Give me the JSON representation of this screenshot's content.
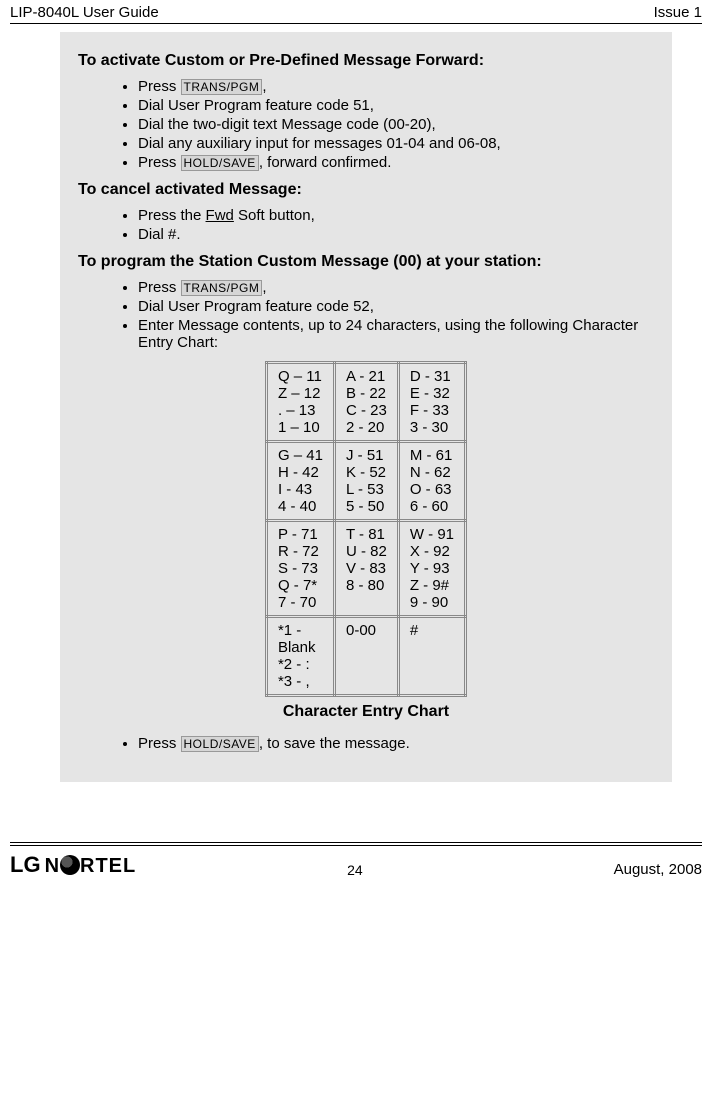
{
  "header": {
    "left": "LIP-8040L User Guide",
    "right": "Issue 1"
  },
  "section1": {
    "heading": "To activate Custom or Pre-Defined Message Forward:",
    "b1_pre": "Press ",
    "b1_key": "TRANS/PGM",
    "b1_post": ",",
    "b2": "Dial User Program feature code 51,",
    "b3": "Dial the two-digit text Message code (00-20),",
    "b4": "Dial any auxiliary input for messages 01-04 and 06-08,",
    "b5_pre": "Press ",
    "b5_key": "HOLD/SAVE",
    "b5_post": ", forward confirmed."
  },
  "section2": {
    "heading": "To cancel activated Message:",
    "b1_pre": "Press the ",
    "b1_soft": "Fwd",
    "b1_post": " Soft button,",
    "b2": "Dial #."
  },
  "section3": {
    "heading": "To program the Station Custom Message (00) at your station:",
    "b1_pre": "Press ",
    "b1_key": "TRANS/PGM",
    "b1_post": ",",
    "b2": "Dial User Program feature code 52,",
    "b3": "Enter Message contents, up to 24 characters, using the following Character Entry Chart:"
  },
  "chart": {
    "r1c1": "Q – 11\nZ – 12\n. – 13\n1 – 10",
    "r1c2": "A - 21\nB - 22\nC - 23\n2 - 20",
    "r1c3": "D - 31\nE - 32\nF - 33\n3 - 30",
    "r2c1": "G – 41\nH - 42\nI - 43\n4 - 40",
    "r2c2": "J - 51\nK - 52\nL - 53\n5 - 50",
    "r2c3": "M - 61\nN - 62\nO - 63\n6 - 60",
    "r3c1": "P - 71\nR - 72\nS - 73\nQ - 7*\n7 - 70",
    "r3c2": "T - 81\nU - 82\nV - 83\n8 - 80",
    "r3c3": "W - 91\nX - 92\nY - 93\nZ - 9#\n9 - 90",
    "r4c1": "*1 -\nBlank\n*2 - :\n*3 - ,",
    "r4c2": "0-00",
    "r4c3": "#",
    "caption": "Character Entry Chart"
  },
  "section4": {
    "b1_pre": "Press ",
    "b1_key": "HOLD/SAVE",
    "b1_post": ", to save the message."
  },
  "footer": {
    "logo_lg": "LG",
    "logo_nortel": "N    RTEL",
    "page": "24",
    "date": "August, 2008"
  }
}
